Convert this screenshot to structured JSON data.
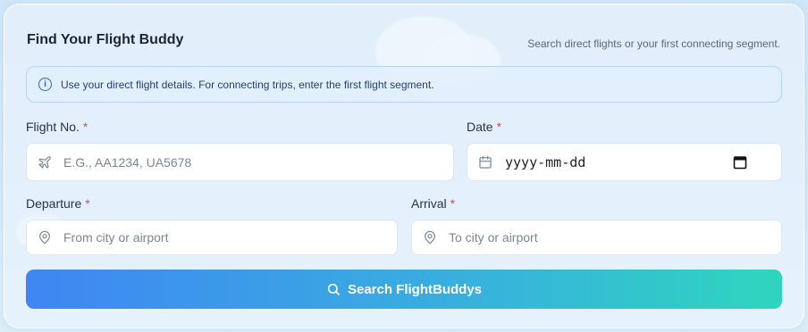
{
  "form": {
    "title": "Find Your Flight Buddy",
    "subtitle": "Search direct flights or your first connecting segment.",
    "notice_text": "Use your direct flight details. For connecting trips, enter the first flight segment.",
    "notice_icon": "info-icon",
    "required_mark": "*",
    "flight_no": {
      "label": "Flight No.",
      "placeholder": "E.G., AA1234, UA5678",
      "icon": "plane-icon"
    },
    "date": {
      "label": "Date",
      "value": "yyyy-mm-dd",
      "icon": "calendar-icon"
    },
    "departure": {
      "label": "Departure",
      "placeholder": "From city or airport",
      "icon": "map-pin-icon"
    },
    "arrival": {
      "label": "Arrival",
      "placeholder": "To city or airport",
      "icon": "map-pin-icon"
    },
    "search_button": {
      "label": "Search FlightBuddys",
      "icon": "search-icon"
    }
  },
  "colors": {
    "accent_start": "#3f86f2",
    "accent_end": "#2fd5be",
    "required": "#e5484d",
    "notice_text": "#24407a"
  }
}
